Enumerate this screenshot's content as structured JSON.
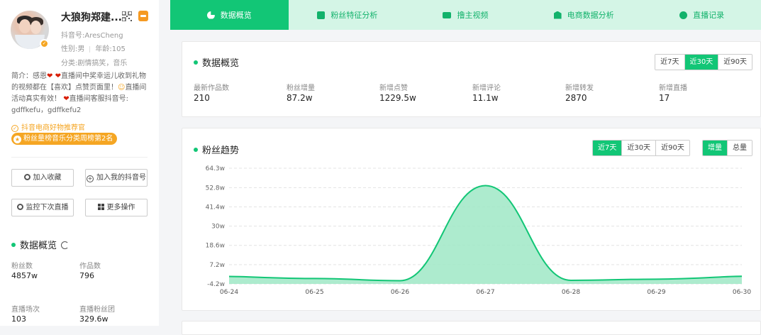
{
  "profile": {
    "name": "大狼狗郑建...",
    "douyin_id": "抖音号:AresCheng",
    "gender": "性别:男",
    "age": "年龄:105",
    "category": "分类:剧情搞笑，音乐",
    "bio_parts": [
      "简介：感恩",
      "直播间中奖幸运儿收到礼物的视频都在【喜欢】点赞页面里！",
      "直播间活动真实有效！",
      "直播间客服抖音号:"
    ],
    "bio_handles": "gdffkefu，gdffkefu2",
    "tag_recommend": "抖音电商好物推荐官",
    "tag_rank": "粉丝量榜音乐分类周榜第2名"
  },
  "actions": {
    "favorite": "加入收藏",
    "add_mine": "加入我的抖音号",
    "monitor": "监控下次直播",
    "more": "更多操作"
  },
  "side_stats": {
    "title": "数据概览",
    "fans_label": "粉丝数",
    "fans_value": "4857w",
    "works_label": "作品数",
    "works_value": "796",
    "live_label": "直播场次",
    "live_value": "103",
    "fangroup_label": "直播粉丝团",
    "fangroup_value": "329.6w"
  },
  "tabs": [
    "数据概览",
    "粉丝特征分析",
    "撸主视频",
    "电商数据分析",
    "直播记录"
  ],
  "overview": {
    "title": "数据概览",
    "ranges": [
      "近7天",
      "近30天",
      "近90天"
    ],
    "active_range": "近30天",
    "metrics": [
      {
        "label": "最新作品数",
        "value": "210"
      },
      {
        "label": "粉丝增量",
        "value": "87.2w"
      },
      {
        "label": "新增点赞",
        "value": "1229.5w"
      },
      {
        "label": "新增评论",
        "value": "11.1w"
      },
      {
        "label": "新增转发",
        "value": "2870"
      },
      {
        "label": "新增直播",
        "value": "17"
      }
    ]
  },
  "trend": {
    "title": "粉丝趋势",
    "ranges": [
      "近7天",
      "近30天",
      "近90天"
    ],
    "active_range": "近7天",
    "modes": [
      "增量",
      "总量"
    ],
    "active_mode": "增量"
  },
  "colors": {
    "accent": "#12c676",
    "tab_bg": "#d4f5e6",
    "orange": "#f5a623"
  },
  "chart_data": {
    "type": "area",
    "x": [
      "06-24",
      "06-25",
      "06-26",
      "06-27",
      "06-28",
      "06-29",
      "06-30"
    ],
    "values": [
      0.2,
      -1.0,
      -2.3,
      54.0,
      -2.1,
      -1.4,
      0.3
    ],
    "y_ticks": [
      "64.3w",
      "52.8w",
      "41.4w",
      "30w",
      "18.6w",
      "7.2w",
      "-4.2w"
    ],
    "ylim": [
      -4.2,
      64.3
    ],
    "unit": "w",
    "grid": true
  }
}
